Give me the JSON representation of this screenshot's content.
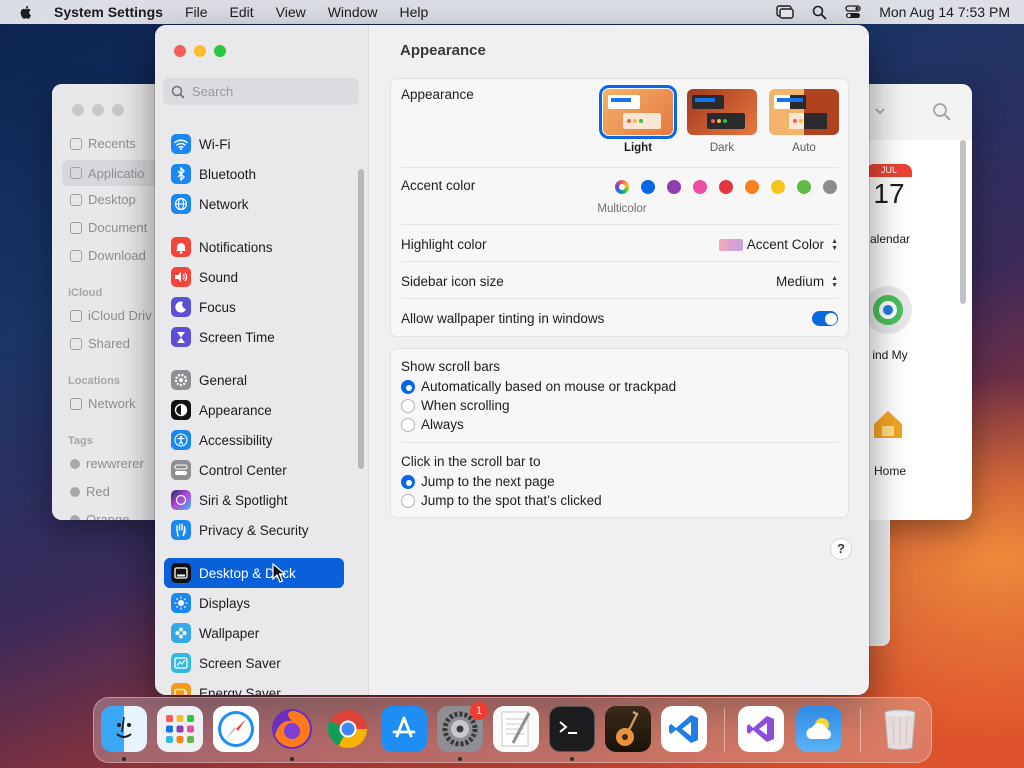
{
  "menubar": {
    "app": "System Settings",
    "items": [
      "File",
      "Edit",
      "View",
      "Window",
      "Help"
    ],
    "clock": "Mon Aug 14  7:53 PM"
  },
  "finder": {
    "sidebar": [
      "Recents",
      "Applicatio",
      "Desktop",
      "Document",
      "Download"
    ],
    "icloud_header": "iCloud",
    "icloud": [
      "iCloud Driv",
      "Shared"
    ],
    "locations_header": "Locations",
    "locations": [
      "Network"
    ],
    "tags_header": "Tags",
    "tags": [
      "rewwrerer",
      "Red",
      "Orange"
    ],
    "apps": {
      "calendar": "alendar",
      "calendar_month": "JUL",
      "calendar_day": "17",
      "findmy": "ind My",
      "home": "Home"
    }
  },
  "sidebar": {
    "search_placeholder": "Search",
    "items": [
      {
        "label": "Wi-Fi",
        "icon": "wifi-icon",
        "color": "#1b87f0"
      },
      {
        "label": "Bluetooth",
        "icon": "bluetooth-icon",
        "color": "#1b87f0"
      },
      {
        "label": "Network",
        "icon": "globe-icon",
        "color": "#1b87f0"
      },
      {
        "label": "Notifications",
        "icon": "bell-icon",
        "color": "#f2463c"
      },
      {
        "label": "Sound",
        "icon": "speaker-icon",
        "color": "#f2463c"
      },
      {
        "label": "Focus",
        "icon": "moon-icon",
        "color": "#5b4fd8"
      },
      {
        "label": "Screen Time",
        "icon": "hourglass-icon",
        "color": "#5b4fd8"
      },
      {
        "label": "General",
        "icon": "gear-icon",
        "color": "#8e8e93"
      },
      {
        "label": "Appearance",
        "icon": "appearance-icon",
        "color": "#111111"
      },
      {
        "label": "Accessibility",
        "icon": "accessibility-icon",
        "color": "#1b87f0"
      },
      {
        "label": "Control Center",
        "icon": "control-center-icon",
        "color": "#8e8e93"
      },
      {
        "label": "Siri & Spotlight",
        "icon": "siri-icon",
        "color": "#6b3fc9"
      },
      {
        "label": "Privacy & Security",
        "icon": "hand-icon",
        "color": "#1b87f0"
      },
      {
        "label": "Desktop & Dock",
        "icon": "dock-icon",
        "color": "#111111"
      },
      {
        "label": "Displays",
        "icon": "sun-icon",
        "color": "#1b87f0"
      },
      {
        "label": "Wallpaper",
        "icon": "flower-icon",
        "color": "#35a8e8"
      },
      {
        "label": "Screen Saver",
        "icon": "screensaver-icon",
        "color": "#35b8e0"
      },
      {
        "label": "Energy Saver",
        "icon": "battery-icon",
        "color": "#f59a1b"
      }
    ]
  },
  "content": {
    "title": "Appearance",
    "appearance": {
      "label": "Appearance",
      "options": [
        "Light",
        "Dark",
        "Auto"
      ],
      "selected": "Light"
    },
    "accent": {
      "label": "Accent color",
      "caption": "Multicolor",
      "colors": [
        "#0a67e4",
        "#8d3fae",
        "#ec4ea0",
        "#e0383e",
        "#f7821b",
        "#f5c51c",
        "#62ba46",
        "#8c8c8c"
      ]
    },
    "highlight": {
      "label": "Highlight color",
      "value": "Accent Color"
    },
    "icon_size": {
      "label": "Sidebar icon size",
      "value": "Medium"
    },
    "tinting": {
      "label": "Allow wallpaper tinting in windows",
      "on": true
    },
    "scrollbars": {
      "label": "Show scroll bars",
      "options": [
        "Automatically based on mouse or trackpad",
        "When scrolling",
        "Always"
      ],
      "selected": 0
    },
    "click": {
      "label": "Click in the scroll bar to",
      "options": [
        "Jump to the next page",
        "Jump to the spot that’s clicked"
      ],
      "selected": 0
    },
    "help": "?"
  },
  "dock": {
    "badge": "1",
    "apps": [
      "finder-icon",
      "launchpad-icon",
      "safari-icon",
      "firefox-icon",
      "chrome-icon",
      "app-store-icon",
      "system-settings-icon",
      "textedit-icon",
      "terminal-icon",
      "garageband-icon",
      "vscode-icon",
      "visual-studio-icon",
      "weather-icon",
      "trash-icon"
    ]
  }
}
